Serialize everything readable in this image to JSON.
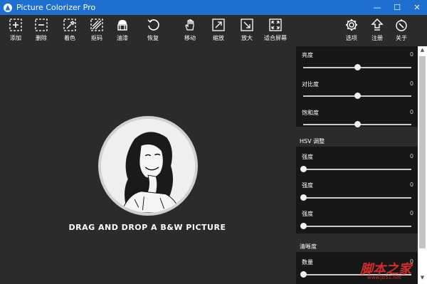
{
  "app": {
    "title": "Picture Colorizer Pro"
  },
  "window_controls": {
    "minimize": "—",
    "maximize": "☐",
    "close": "✕"
  },
  "toolbar": {
    "add": "添加",
    "delete": "删除",
    "colorize": "着色",
    "mask": "抠码",
    "fill": "油漆",
    "restore": "恢复",
    "move": "移动",
    "zoom_out": "缩放",
    "zoom_in": "放大",
    "fit_screen": "适合屏幕",
    "options": "选项",
    "register": "注册",
    "about": "关于"
  },
  "canvas": {
    "drop_text": "DRAG AND DROP A B&W PICTURE"
  },
  "panel": {
    "basic": [
      {
        "label": "亮度",
        "value": "0",
        "level": 0.5
      },
      {
        "label": "对比度",
        "value": "0",
        "level": 0.5
      },
      {
        "label": "饱和度",
        "value": "0",
        "level": 0.5
      }
    ],
    "hsv_title": "HSV 调整",
    "hsv": [
      {
        "label": "强度",
        "value": "0",
        "level": 0
      },
      {
        "label": "强度",
        "value": "0",
        "level": 0
      },
      {
        "label": "强度",
        "value": "0",
        "level": 0
      }
    ],
    "sharpness_title": "清晰度",
    "sharpness": [
      {
        "label": "数量",
        "value": "0",
        "level": 0
      }
    ]
  },
  "watermark": {
    "main": "脚本之家",
    "sub": "www.jb51.net"
  }
}
